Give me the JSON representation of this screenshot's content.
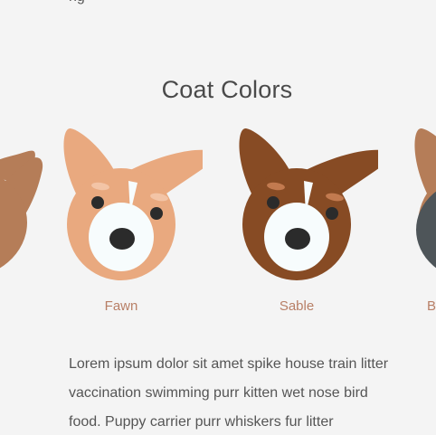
{
  "header": {
    "cut_text": "ng"
  },
  "section": {
    "title": "Coat Colors"
  },
  "coats": [
    {
      "label": "",
      "color": "#b57d58"
    },
    {
      "label": "Fawn",
      "color": "#e9a97f"
    },
    {
      "label": "Sable",
      "color": "#874b24"
    },
    {
      "label": "B",
      "color": "#b57d58",
      "secondary": "#4e5559"
    }
  ],
  "body": {
    "paragraph": "Lorem ipsum dolor sit amet spike house train litter vaccination swimming purr kitten wet nose bird food. Puppy carrier purr whiskers fur litter"
  },
  "colors": {
    "background": "#f4f4f4",
    "label_accent": "#b87f66",
    "text": "#555555",
    "muzzle": "#f7fcfd",
    "eye": "#2b2b2b"
  }
}
